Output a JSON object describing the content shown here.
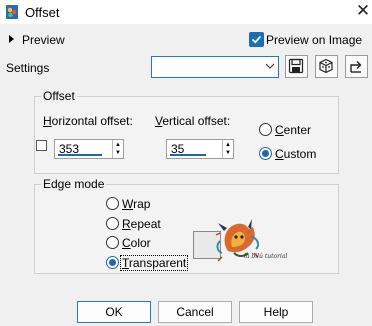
{
  "window": {
    "title": "Offset",
    "app_icon": "paint-shop-pro-icon",
    "close_icon": "close-icon"
  },
  "preview": {
    "label": "Preview",
    "on_image_label": "Preview on Image",
    "on_image_checked": true
  },
  "settings": {
    "label": "Settings",
    "value": "",
    "buttons": [
      "save-preset-icon",
      "randomize-icon",
      "reset-icon"
    ]
  },
  "offset_group": {
    "title": "Offset",
    "horizontal": {
      "label_first": "H",
      "label_rest": "orizontal offset:",
      "value": "353"
    },
    "vertical": {
      "label_first": "V",
      "label_rest": "ertical offset:",
      "value": "35"
    },
    "center": {
      "label_first": "C",
      "label_rest": "enter",
      "selected": false
    },
    "custom": {
      "label_first": "C",
      "label_rest": "ustom",
      "selected": true
    }
  },
  "edge_group": {
    "title": "Edge mode",
    "wrap": {
      "label_first": "W",
      "label_rest": "rap",
      "selected": false
    },
    "repeat": {
      "label_first": "R",
      "label_rest": "epeat",
      "selected": false
    },
    "color": {
      "label_first": "C",
      "label_rest": "olor",
      "selected": false
    },
    "transparent": {
      "label_first": "T",
      "label_rest": "ransparent",
      "selected": true
    },
    "watermark_text": "la bilû tutorial"
  },
  "buttons": {
    "ok": "OK",
    "cancel": "Cancel",
    "help": "Help"
  },
  "colors": {
    "accent": "#1f66b3"
  }
}
